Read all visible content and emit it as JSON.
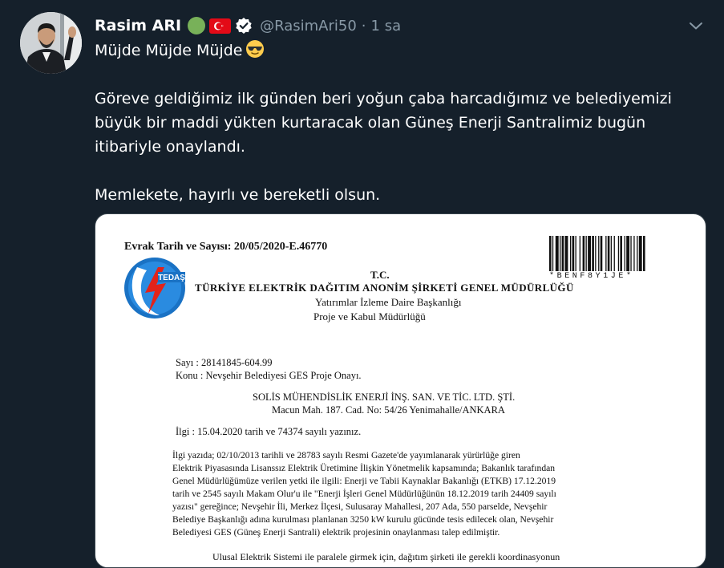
{
  "tweet": {
    "author_name": "Rasim ARI",
    "handle": "@RasimAri50",
    "separator": "·",
    "time": "1 sa",
    "lines": [
      "Müjde Müjde Müjde",
      "",
      "Göreve geldiğimiz ilk günden beri yoğun çaba harcadığımız ve belediyemizi",
      "büyük bir maddi yükten kurtaracak olan Güneş Enerji Santralimiz bugün",
      "itibariyle onaylandı.",
      "",
      "Memlekete, hayırlı ve bereketli olsun."
    ],
    "icons": {
      "green_circle": "green-circle-emoji",
      "flag": "turkey-flag-emoji",
      "verified": "verified-badge-icon",
      "sunglasses": "sunglasses-emoji",
      "caret": "chevron-down-icon"
    },
    "colors": {
      "background": "#15202b",
      "text": "#ffffff",
      "secondary": "#8899a6",
      "border": "#38444d"
    }
  },
  "document": {
    "evrak": "Evrak Tarih ve Sayısı: 20/05/2020-E.46770",
    "tc": "T.C.",
    "company": "TÜRKİYE ELEKTRİK DAĞITIM ANONİM ŞİRKETİ GENEL MÜDÜRLÜĞÜ",
    "dept1": "Yatırımlar İzleme Daire Başkanlığı",
    "dept2": "Proje ve Kabul Müdürlüğü",
    "logo_text": "TEDAŞ",
    "barcode_text": "*BENF8Y1JE*",
    "sayi": "Sayı   : 28141845-604.99",
    "konu": "Konu : Nevşehir Belediyesi GES Proje Onayı.",
    "recipient": "SOLİS MÜHENDİSLİK ENERJİ İNŞ. SAN. VE TİC. LTD. ŞTİ.",
    "address": "Macun Mah. 187. Cad. No: 54/26 Yenimahalle/ANKARA",
    "ilgi": "İlgi  :        15.04.2020 tarih ve 74374 sayılı yazınız.",
    "body_lines": [
      "         İlgi yazıda; 02/10/2013 tarihli ve 28783 sayılı Resmi Gazete'de yayımlanarak yürürlüğe giren",
      "Elektrik Piyasasında Lisanssız Elektrik Üretimine İlişkin Yönetmelik kapsamında; Bakanlık tarafından",
      "Genel Müdürlüğümüze verilen yetki ile ilgili: Enerji ve Tabii Kaynaklar Bakanlığı (ETKB) 17.12.2019",
      "tarih ve 2545 sayılı Makam Olur'u ile \"Enerji İşleri Genel Müdürlüğünün 18.12.2019 tarih 24409 sayılı",
      "yazısı\" gereğince; Nevşehir İli, Merkez İlçesi, Sulusaray Mahallesi, 207 Ada, 550 parselde, Nevşehir",
      "Belediye Başkanlığı adına kurulması planlanan 3250 kW kurulu gücünde tesis edilecek olan, Nevşehir",
      "Belediyesi GES (Güneş Enerji Santrali)  elektrik projesinin onaylanması talep edilmiştir."
    ],
    "cut_line": "Ulusal Elektrik Sistemi ile paralele girmek için, dağıtım şirketi ile gerekli koordinasyonun"
  }
}
